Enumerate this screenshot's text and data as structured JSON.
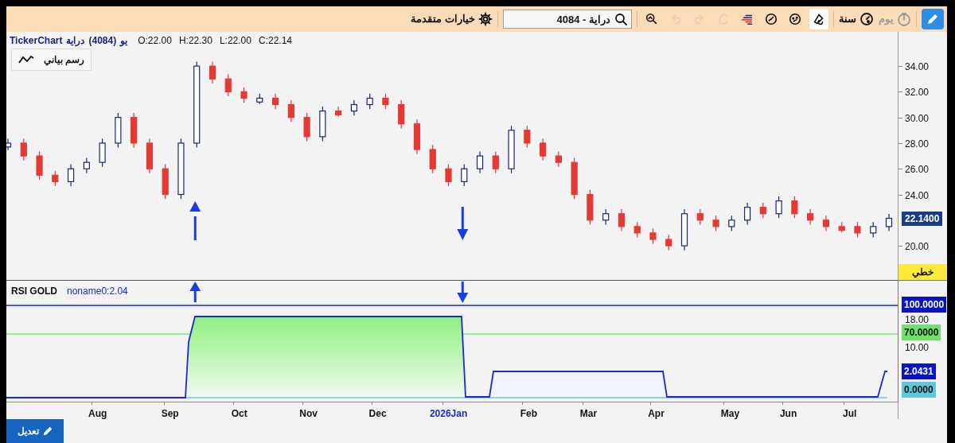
{
  "toolbar": [
    {
      "kind": "mode",
      "selected": true
    },
    {
      "kind": "period",
      "label": "يوم",
      "disabled": true
    },
    {
      "kind": "period",
      "label": "سنة",
      "disabled": false
    },
    {
      "kind": "tool",
      "selected": true,
      "disabled": false
    },
    {
      "kind": "tool",
      "selected": false,
      "disabled": false
    },
    {
      "kind": "tool",
      "selected": false,
      "disabled": false
    },
    {
      "kind": "tool",
      "selected": false,
      "disabled": false
    },
    {
      "kind": "tool",
      "selected": false,
      "disabled": true
    },
    {
      "kind": "tool",
      "selected": false,
      "disabled": true
    },
    {
      "kind": "tool",
      "selected": false,
      "disabled": true
    },
    {
      "kind": "tool",
      "selected": false,
      "disabled": false
    },
    {
      "kind": "search",
      "value": "دراية - 4084"
    },
    {
      "kind": "settings",
      "label": "خيارات متقدمة"
    }
  ],
  "info": {
    "app": "TickerChart",
    "name": "دراية",
    "code": "(4084)",
    "period": "يو",
    "ohlc": [
      "O:22.00",
      "H:22.30",
      "L:22.00",
      "C:22.14"
    ]
  },
  "legend": {
    "label": "رسم بياني"
  },
  "price_chart": {
    "chart_data": {
      "type": "candlestick",
      "ylim": [
        17.34,
        36.67
      ],
      "yticks": [
        {
          "value": 20,
          "label": "20.00"
        },
        {
          "value": 24,
          "label": "24.00"
        },
        {
          "value": 26,
          "label": "26.00"
        },
        {
          "value": 28,
          "label": "28.00"
        },
        {
          "value": 30,
          "label": "30.00"
        },
        {
          "value": 32,
          "label": "32.00"
        },
        {
          "value": 34,
          "label": "34.00"
        }
      ],
      "ohlc": [
        [
          27.7,
          28.35,
          27.45,
          28.0
        ],
        [
          28.0,
          28.35,
          26.65,
          27.0
        ],
        [
          27.0,
          27.35,
          25.15,
          25.5
        ],
        [
          25.5,
          25.85,
          24.65,
          25.0
        ],
        [
          25.0,
          26.35,
          24.65,
          26.0
        ],
        [
          26.0,
          26.85,
          25.65,
          26.5
        ],
        [
          26.5,
          28.35,
          26.15,
          28.0
        ],
        [
          28.0,
          30.35,
          27.65,
          30.0
        ],
        [
          30.0,
          30.35,
          27.65,
          28.0
        ],
        [
          28.0,
          28.35,
          25.65,
          26.0
        ],
        [
          26.0,
          26.35,
          23.65,
          24.0
        ],
        [
          24.0,
          28.35,
          23.65,
          28.0
        ],
        [
          28.0,
          34.35,
          27.65,
          34.0
        ],
        [
          34.0,
          34.35,
          32.65,
          33.0
        ],
        [
          33.0,
          33.35,
          31.65,
          32.0
        ],
        [
          32.0,
          32.35,
          31.15,
          31.5
        ],
        [
          31.2,
          31.85,
          31.05,
          31.5
        ],
        [
          31.5,
          31.85,
          30.65,
          31.0
        ],
        [
          31.0,
          31.35,
          29.65,
          30.0
        ],
        [
          30.0,
          30.35,
          28.15,
          28.5
        ],
        [
          28.5,
          30.85,
          28.15,
          30.5
        ],
        [
          30.5,
          30.85,
          30.05,
          30.2
        ],
        [
          30.5,
          31.35,
          30.15,
          31.0
        ],
        [
          31.0,
          31.85,
          30.65,
          31.5
        ],
        [
          31.5,
          31.85,
          30.65,
          31.0
        ],
        [
          31.0,
          31.35,
          29.15,
          29.5
        ],
        [
          29.5,
          29.85,
          27.15,
          27.5
        ],
        [
          27.5,
          27.85,
          25.65,
          26.0
        ],
        [
          26.0,
          26.35,
          24.65,
          25.0
        ],
        [
          25.0,
          26.35,
          24.65,
          26.0
        ],
        [
          26.0,
          27.35,
          25.65,
          27.0
        ],
        [
          27.0,
          27.35,
          25.65,
          26.0
        ],
        [
          26.0,
          29.35,
          25.65,
          29.0
        ],
        [
          29.0,
          29.35,
          27.65,
          28.0
        ],
        [
          28.0,
          28.35,
          26.65,
          27.0
        ],
        [
          27.0,
          27.35,
          26.15,
          26.5
        ],
        [
          26.5,
          26.85,
          23.65,
          24.0
        ],
        [
          24.0,
          24.35,
          21.65,
          22.0
        ],
        [
          22.0,
          22.85,
          21.65,
          22.5
        ],
        [
          22.5,
          22.85,
          21.15,
          21.5
        ],
        [
          21.5,
          21.85,
          20.65,
          21.0
        ],
        [
          21.0,
          21.35,
          20.15,
          20.5
        ],
        [
          20.5,
          20.85,
          19.65,
          20.0
        ],
        [
          20.0,
          22.85,
          19.65,
          22.5
        ],
        [
          22.5,
          22.85,
          21.65,
          22.0
        ],
        [
          22.0,
          22.35,
          21.15,
          21.5
        ],
        [
          21.5,
          22.35,
          21.15,
          22.0
        ],
        [
          22.0,
          23.35,
          21.65,
          23.0
        ],
        [
          23.0,
          23.35,
          22.15,
          22.5
        ],
        [
          22.5,
          23.85,
          22.15,
          23.5
        ],
        [
          23.5,
          23.85,
          22.15,
          22.5
        ],
        [
          22.5,
          22.85,
          21.65,
          22.0
        ],
        [
          22.0,
          22.35,
          21.15,
          21.5
        ],
        [
          21.5,
          21.85,
          21.05,
          21.2
        ],
        [
          21.5,
          21.85,
          20.65,
          21.0
        ],
        [
          21.0,
          21.85,
          20.65,
          21.5
        ],
        [
          21.5,
          22.49,
          21.15,
          22.14
        ]
      ]
    },
    "markers": [
      {
        "kind": "up"
      },
      {
        "kind": "down"
      }
    ],
    "last_price": "22.1400",
    "line_type": "خطي"
  },
  "rsi": {
    "title": "RSI GOLD",
    "value": "noname0:2.04",
    "axis": [
      {
        "kind": "badge",
        "text": "100.0000",
        "color": "#0a12c8"
      },
      {
        "kind": "label",
        "text": "18.00"
      },
      {
        "kind": "badge",
        "text": "70.0000",
        "color": "#6fe06a"
      },
      {
        "kind": "label",
        "text": "10.00"
      },
      {
        "kind": "badge",
        "text": "2.0431",
        "color": "#0a12c8"
      },
      {
        "kind": "badge",
        "text": "0.0000",
        "color": "#5cc8d8"
      }
    ]
  },
  "time_axis": [
    "Aug",
    "Sep",
    "Oct",
    "Nov",
    "Dec",
    "2026Jan",
    "Feb",
    "Mar",
    "Apr",
    "May",
    "Jun",
    "Jul"
  ],
  "edit_button": {
    "label": "تعديل"
  }
}
